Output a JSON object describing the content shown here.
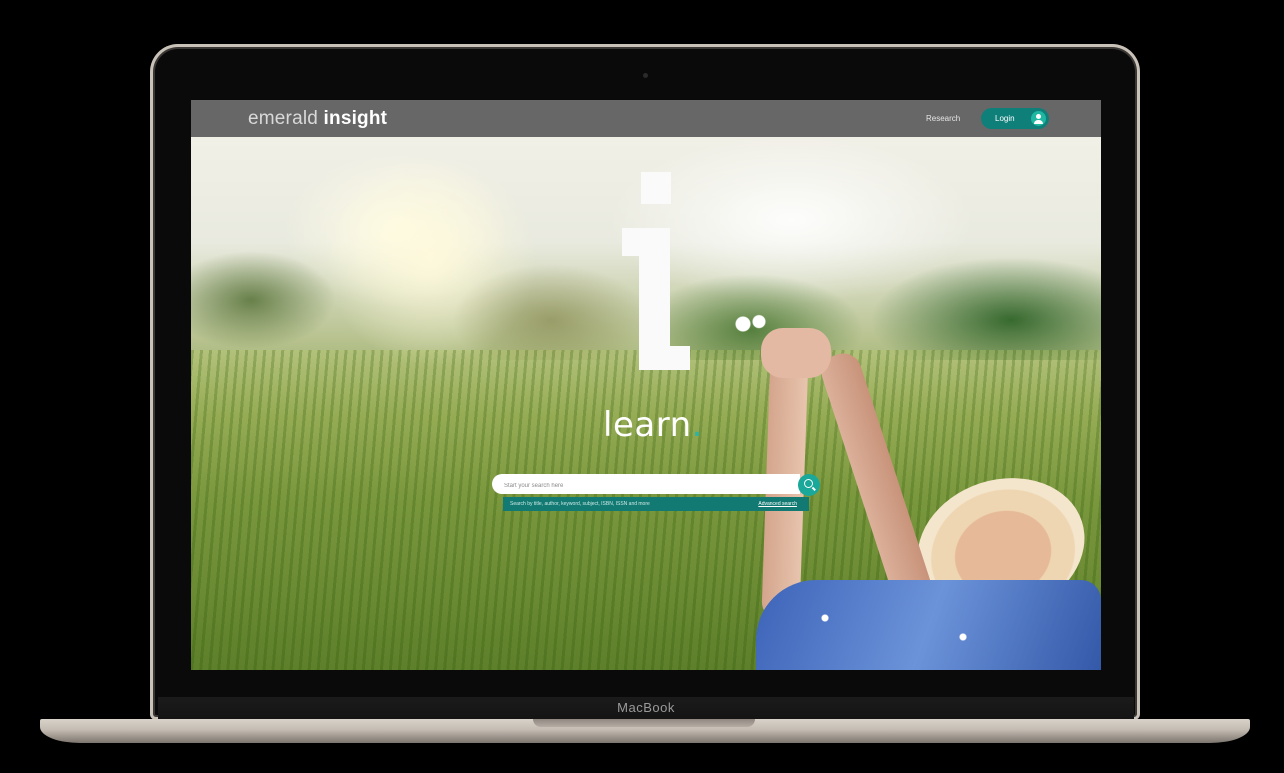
{
  "device": {
    "chin_label": "MacBook"
  },
  "navbar": {
    "brand_light": "emerald ",
    "brand_bold": "insight",
    "link_label": "Research",
    "login_label": "Login"
  },
  "hero": {
    "letter": "i",
    "word": "learn",
    "word_dot": "."
  },
  "search": {
    "placeholder": "Start your search here",
    "hint": "Search by title, author, keyword, subject, ISBN, ISSN and more",
    "advanced_label": "Advanced search"
  },
  "colors": {
    "accent": "#0f7f7a",
    "accent_light": "#1fb7a2",
    "navbar": "#5c5c5c"
  }
}
